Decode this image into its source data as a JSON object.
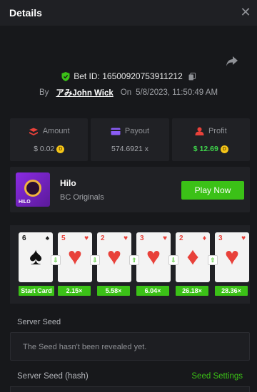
{
  "header": {
    "title": "Details"
  },
  "bet": {
    "id_text": "Bet ID: 16500920753911212",
    "by_label": "By",
    "user": "アみJohn Wick",
    "on_label": "On",
    "date": "5/8/2023, 11:50:49 AM"
  },
  "stats": {
    "amount": {
      "label": "Amount",
      "value": "$ 0.02"
    },
    "payout": {
      "label": "Payout",
      "value": "574.6921 x"
    },
    "profit": {
      "label": "Profit",
      "value": "$ 12.69"
    }
  },
  "game": {
    "name": "Hilo",
    "provider": "BC Originals",
    "thumb_text": "HILO",
    "play_label": "Play Now"
  },
  "cards": [
    {
      "rank": "6",
      "suit": "♠",
      "color": "black",
      "multiplier": "Start Card"
    },
    {
      "rank": "5",
      "suit": "♥",
      "color": "red",
      "multiplier": "2.15×"
    },
    {
      "rank": "2",
      "suit": "♥",
      "color": "red",
      "multiplier": "5.58×"
    },
    {
      "rank": "3",
      "suit": "♥",
      "color": "red",
      "multiplier": "6.04×"
    },
    {
      "rank": "2",
      "suit": "♦",
      "color": "red",
      "multiplier": "26.18×"
    },
    {
      "rank": "3",
      "suit": "♥",
      "color": "red",
      "multiplier": "28.36×"
    }
  ],
  "seed": {
    "server_seed_label": "Server Seed",
    "server_seed_text": "The Seed hasn't been revealed yet.",
    "hash_label": "Server Seed (hash)",
    "settings_label": "Seed Settings"
  },
  "colors": {
    "accent": "#3bc117",
    "background": "#17181b",
    "panel": "#202125",
    "heart": "#e8413a",
    "coin": "#f5c518"
  }
}
